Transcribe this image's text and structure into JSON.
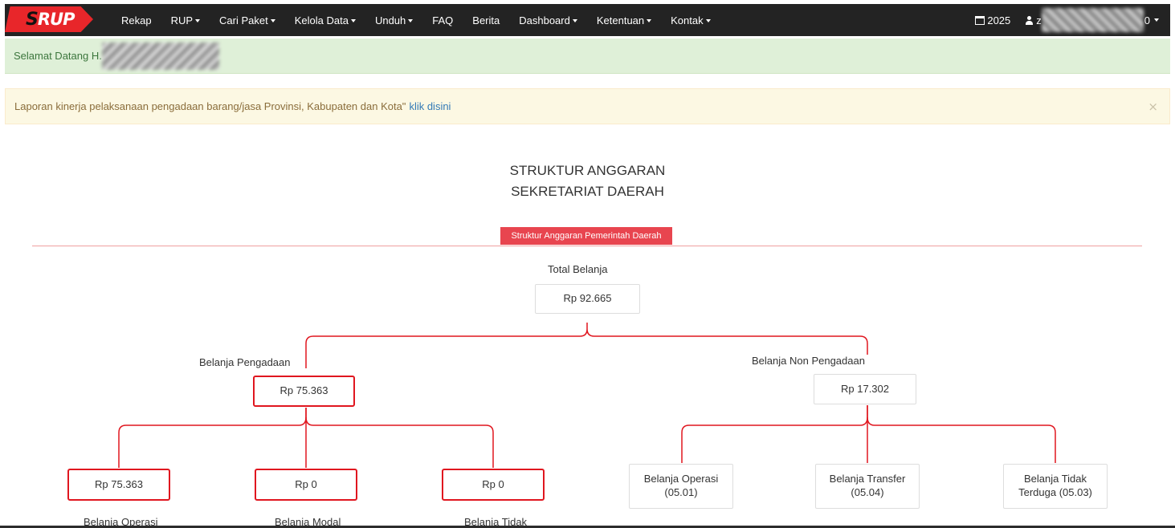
{
  "navbar": {
    "items": [
      {
        "label": "Rekap",
        "caret": false
      },
      {
        "label": "RUP",
        "caret": true
      },
      {
        "label": "Cari Paket",
        "caret": true
      },
      {
        "label": "Kelola Data",
        "caret": true
      },
      {
        "label": "Unduh",
        "caret": true
      },
      {
        "label": "FAQ",
        "caret": false
      },
      {
        "label": "Berita",
        "caret": false
      },
      {
        "label": "Dashboard",
        "caret": true
      },
      {
        "label": "Ketentuan",
        "caret": true
      },
      {
        "label": "Kontak",
        "caret": true
      }
    ],
    "year": "2025",
    "user_prefix": "z",
    "user_suffix": "0"
  },
  "welcome": {
    "text": "Selamat Datang H."
  },
  "alert": {
    "text": "Laporan kinerja pelaksanaan pengadaan barang/jasa Provinsi, Kabupaten dan Kota\"",
    "link": "klik disini",
    "close": "×"
  },
  "title": {
    "line1": "STRUKTUR ANGGARAN",
    "line2": "SEKRETARIAT DAERAH"
  },
  "section_label": "Struktur Anggaran Pemerintah Daerah",
  "tree": {
    "total": {
      "label": "Total Belanja",
      "value": "Rp 92.665"
    },
    "pengadaan": {
      "label": "Belanja Pengadaan",
      "value": "Rp 75.363"
    },
    "non_pengadaan": {
      "label": "Belanja Non Pengadaan",
      "value": "Rp 17.302"
    },
    "pengadaan_children": [
      {
        "value": "Rp 75.363",
        "label": "Belanja Operasi"
      },
      {
        "value": "Rp 0",
        "label": "Belanja Modal"
      },
      {
        "value": "Rp 0",
        "label": "Belanja Tidak"
      }
    ],
    "non_pengadaan_children": [
      {
        "line1": "Belanja Operasi",
        "line2": "(05.01)"
      },
      {
        "line1": "Belanja Transfer",
        "line2": "(05.04)"
      },
      {
        "line1": "Belanja Tidak",
        "line2": "Terduga (05.03)"
      }
    ]
  }
}
